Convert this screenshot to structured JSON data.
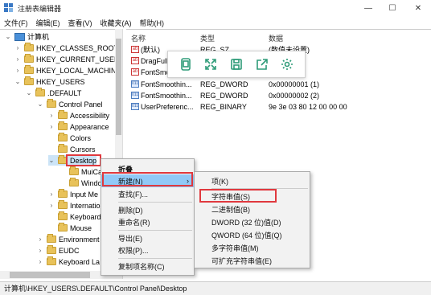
{
  "window": {
    "title": "注册表编辑器"
  },
  "menubar": [
    "文件(F)",
    "编辑(E)",
    "查看(V)",
    "收藏夹(A)",
    "帮助(H)"
  ],
  "tree": {
    "root": "计算机",
    "nodes": [
      "HKEY_CLASSES_ROOT",
      "HKEY_CURRENT_USER",
      "HKEY_LOCAL_MACHINE",
      "HKEY_USERS",
      ".DEFAULT",
      "Control Panel",
      "Accessibility",
      "Appearance",
      "Colors",
      "Cursors",
      "Desktop",
      "MuiCa",
      "Windo",
      "Input Me",
      "Internatio",
      "Keyboard",
      "Mouse",
      "Environment",
      "EUDC",
      "Keyboard La"
    ]
  },
  "list": {
    "headers": [
      "名称",
      "类型",
      "数据"
    ],
    "rows": [
      {
        "name": "(默认)",
        "type": "REG_SZ",
        "data": "(数值未设置)",
        "icon": "ab"
      },
      {
        "name": "DragFull",
        "type": "",
        "data": "",
        "icon": "ab"
      },
      {
        "name": "FontSmo",
        "type": "",
        "data": "",
        "icon": "ab"
      },
      {
        "name": "FontSmoothin...",
        "type": "REG_DWORD",
        "data": "0x00000001 (1)",
        "icon": "bin"
      },
      {
        "name": "FontSmoothin...",
        "type": "REG_DWORD",
        "data": "0x00000002 (2)",
        "icon": "bin"
      },
      {
        "name": "UserPreferenc...",
        "type": "REG_BINARY",
        "data": "9e 3e 03 80 12 00 00 00",
        "icon": "bin"
      }
    ]
  },
  "context_menu": {
    "items": [
      "折叠",
      "新建(N)",
      "查找(F)...",
      "删除(D)",
      "重命名(R)",
      "导出(E)",
      "权限(P)...",
      "复制项名称(C)"
    ],
    "submenu_arrow": "›"
  },
  "submenu": {
    "items": [
      "项(K)",
      "字符串值(S)",
      "二进制值(B)",
      "DWORD (32 位)值(D)",
      "QWORD (64 位)值(Q)",
      "多字符串值(M)",
      "可扩充字符串值(E)"
    ]
  },
  "statusbar": {
    "path": "计算机\\HKEY_USERS\\.DEFAULT\\Control Panel\\Desktop"
  },
  "window_controls": {
    "minimize": "—",
    "maximize": "☐",
    "close": "✕"
  },
  "colors": {
    "highlight": "#91c9f7",
    "red_box": "#e0393e",
    "toolbar_icon": "#2e9b78"
  }
}
